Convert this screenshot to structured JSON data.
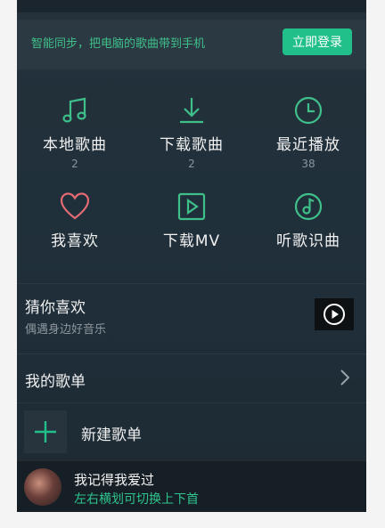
{
  "sync": {
    "text": "智能同步，把电脑的歌曲带到手机",
    "login_label": "立即登录"
  },
  "grid": [
    {
      "label": "本地歌曲",
      "count": "2",
      "icon": "music-note-icon"
    },
    {
      "label": "下载歌曲",
      "count": "2",
      "icon": "download-icon"
    },
    {
      "label": "最近播放",
      "count": "38",
      "icon": "clock-icon"
    },
    {
      "label": "我喜欢",
      "count": "",
      "icon": "heart-icon"
    },
    {
      "label": "下载MV",
      "count": "",
      "icon": "video-play-icon"
    },
    {
      "label": "听歌识曲",
      "count": "",
      "icon": "music-recognize-icon"
    }
  ],
  "guess": {
    "title": "猜你喜欢",
    "subtitle": "偶遇身边好音乐"
  },
  "my_list": {
    "label": "我的歌单"
  },
  "new_list": {
    "label": "新建歌单"
  },
  "player": {
    "song": "我记得我爱过",
    "hint": "左右横划可切换上下首"
  },
  "colors": {
    "accent": "#21c08b",
    "icon_green": "#3fbf8a",
    "heart": "#e26a72",
    "bg": "#22303a"
  }
}
